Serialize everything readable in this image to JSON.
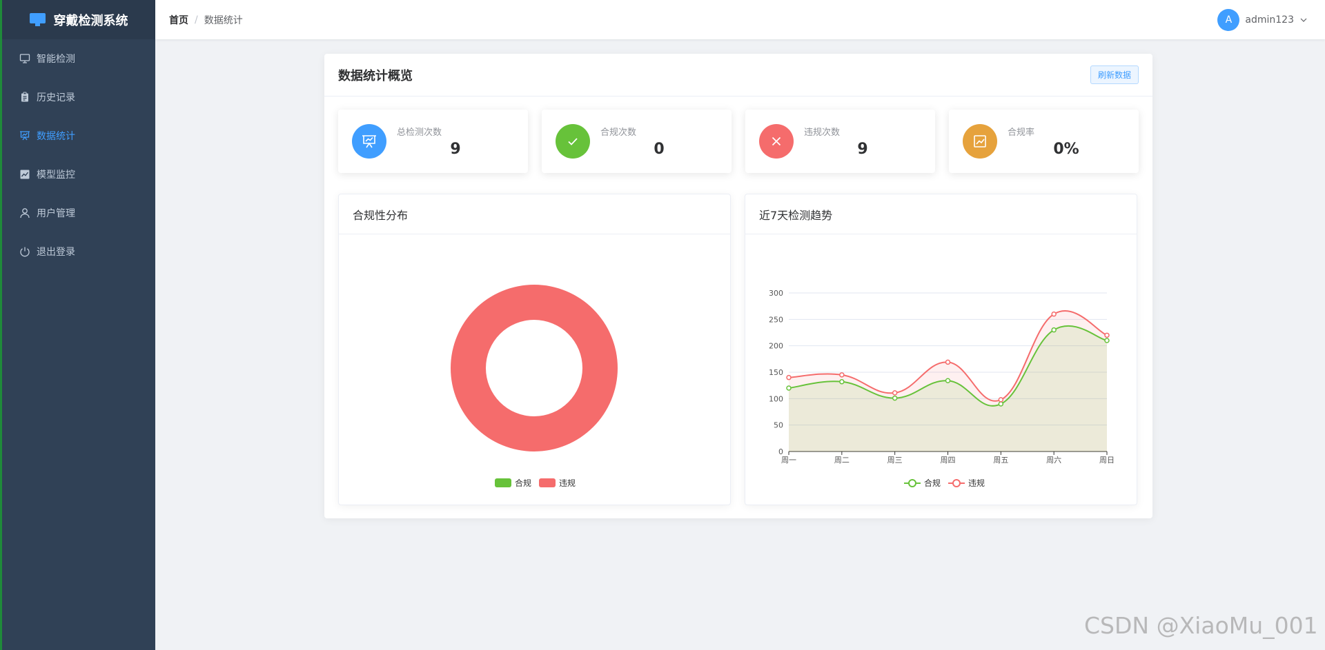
{
  "app": {
    "title": "穿戴检测系统"
  },
  "sidebar": {
    "items": [
      {
        "label": "智能检测",
        "icon": "monitor-icon",
        "active": false
      },
      {
        "label": "历史记录",
        "icon": "clipboard-icon",
        "active": false
      },
      {
        "label": "数据统计",
        "icon": "presentation-chart-icon",
        "active": true
      },
      {
        "label": "模型监控",
        "icon": "line-chart-icon",
        "active": false
      },
      {
        "label": "用户管理",
        "icon": "user-icon",
        "active": false
      },
      {
        "label": "退出登录",
        "icon": "power-icon",
        "active": false
      }
    ]
  },
  "header": {
    "breadcrumb": {
      "home": "首页",
      "separator": "/",
      "current": "数据统计"
    },
    "user": {
      "avatar_letter": "A",
      "name": "admin123"
    }
  },
  "panel": {
    "title": "数据统计概览",
    "refresh_label": "刷新数据",
    "stats": [
      {
        "label": "总检测次数",
        "value": "9",
        "color": "#409eff",
        "icon": "presentation-icon"
      },
      {
        "label": "合规次数",
        "value": "0",
        "color": "#67c23a",
        "icon": "check-icon"
      },
      {
        "label": "违规次数",
        "value": "9",
        "color": "#f56c6c",
        "icon": "close-icon"
      },
      {
        "label": "合规率",
        "value": "0%",
        "color": "#e6a23c",
        "icon": "trend-icon"
      }
    ]
  },
  "chart_data": [
    {
      "type": "pie",
      "title": "合规性分布",
      "labels": [
        "合规",
        "违规"
      ],
      "values": [
        0,
        9
      ],
      "colors": [
        "#67c23a",
        "#f56c6c"
      ],
      "donut": true,
      "legend": "bottom"
    },
    {
      "type": "line",
      "title": "近7天检测趋势",
      "categories": [
        "周一",
        "周二",
        "周三",
        "周四",
        "周五",
        "周六",
        "周日"
      ],
      "series": [
        {
          "name": "合规",
          "values": [
            120,
            132,
            101,
            134,
            90,
            230,
            210
          ],
          "color": "#67c23a"
        },
        {
          "name": "违规",
          "values": [
            140,
            145,
            111,
            169,
            98,
            260,
            220
          ],
          "color": "#f56c6c"
        }
      ],
      "yticks": [
        0,
        50,
        100,
        150,
        200,
        250,
        300
      ],
      "ylim": [
        0,
        300
      ],
      "smooth": true,
      "area": true,
      "grid": true,
      "legend": "bottom"
    }
  ],
  "watermark": "CSDN @XiaoMu_001"
}
